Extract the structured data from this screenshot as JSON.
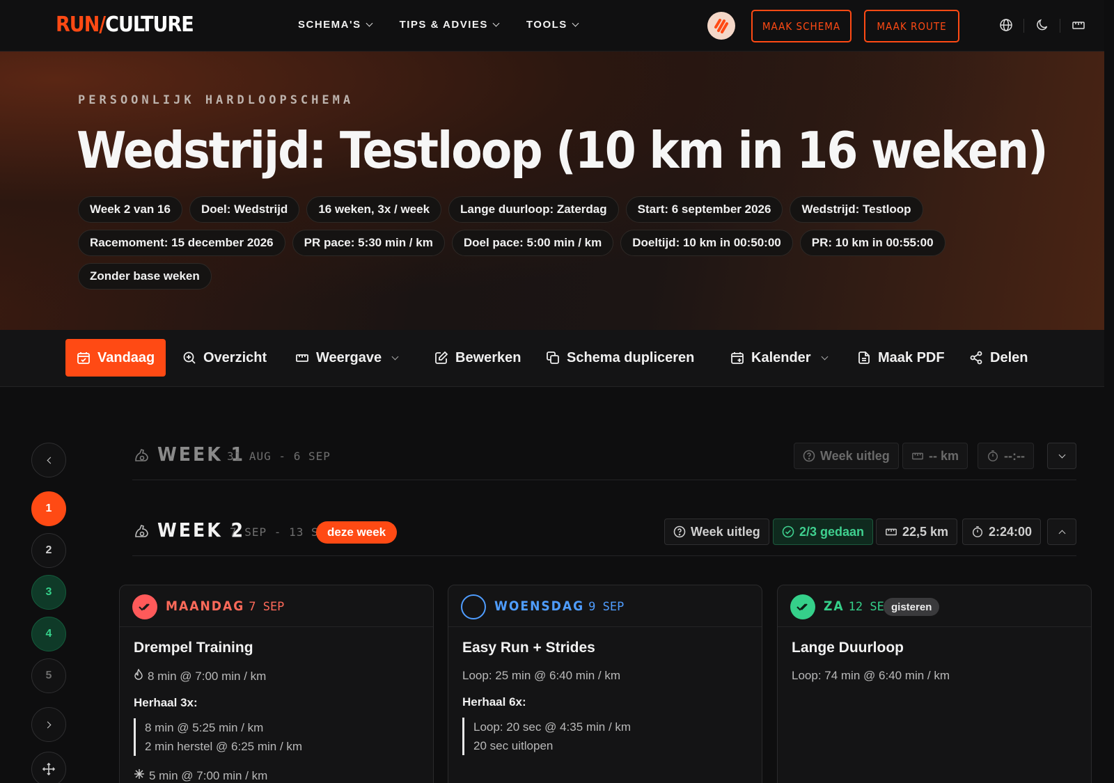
{
  "brand": {
    "part1": "RUN",
    "slash": "/",
    "part2": "CULTURE"
  },
  "nav": {
    "items": [
      "SCHEMA'S",
      "TIPS & ADVIES",
      "TOOLS"
    ],
    "cta_schema": "MAAK SCHEMA",
    "cta_route": "MAAK ROUTE"
  },
  "hero": {
    "kicker": "PERSOONLIJK HARDLOOPSCHEMA",
    "title": "Wedstrijd: Testloop (10 km in 16 weken)",
    "chips": [
      "Week 2 van 16",
      "Doel: Wedstrijd",
      "16 weken, 3x / week",
      "Lange duurloop: Zaterdag",
      "Start: 6 september 2026",
      "Wedstrijd: Testloop",
      "Racemoment: 15 december 2026",
      "PR pace: 5:30 min / km",
      "Doel pace: 5:00 min / km",
      "Doeltijd: 10 km in 00:50:00",
      "PR: 10 km in 00:55:00",
      "Zonder base weken"
    ]
  },
  "toolbar": {
    "today": "Vandaag",
    "overview": "Overzicht",
    "view": "Weergave",
    "edit": "Bewerken",
    "duplicate": "Schema dupliceren",
    "calendar": "Kalender",
    "pdf": "Maak PDF",
    "share": "Delen"
  },
  "rail": {
    "weeks": [
      "1",
      "2",
      "3",
      "4",
      "5"
    ]
  },
  "weeks": [
    {
      "title": "WEEK 1",
      "range": "31 AUG - 6 SEP",
      "explain": "Week uitleg",
      "distance": "-- km",
      "time": "--:--"
    },
    {
      "title": "WEEK 2",
      "range": "7 SEP - 13 SEP",
      "badge": "deze week",
      "explain": "Week uitleg",
      "done": "2/3 gedaan",
      "distance": "22,5 km",
      "time": "2:24:00"
    }
  ],
  "cards": [
    {
      "day": "MAANDAG",
      "date": "7 SEP",
      "color": "#ff5a5a",
      "title": "Drempel Training",
      "warmup": "8 min @ 7:00 min / km",
      "repeat": "Herhaal 3x:",
      "block": [
        "8 min @ 5:25 min / km",
        "2 min herstel @ 6:25 min / km"
      ],
      "cooldown": "5 min @ 7:00 min / km"
    },
    {
      "day": "WOENSDAG",
      "date": "9 SEP",
      "color": "#4f9dff",
      "title": "Easy Run + Strides",
      "line": "Loop: 25 min @ 6:40 min / km",
      "repeat": "Herhaal 6x:",
      "block": [
        "Loop: 20 sec @ 4:35 min / km",
        "20 sec uitlopen"
      ]
    },
    {
      "day": "ZA",
      "date": "12 SEP",
      "tag": "gisteren",
      "color": "#35d08a",
      "title": "Lange Duurloop",
      "line": "Loop: 74 min @ 6:40 min / km"
    }
  ],
  "colors": {
    "accent": "#ff4a14",
    "done": "#35d08a",
    "bg": "#0e0e0f"
  }
}
